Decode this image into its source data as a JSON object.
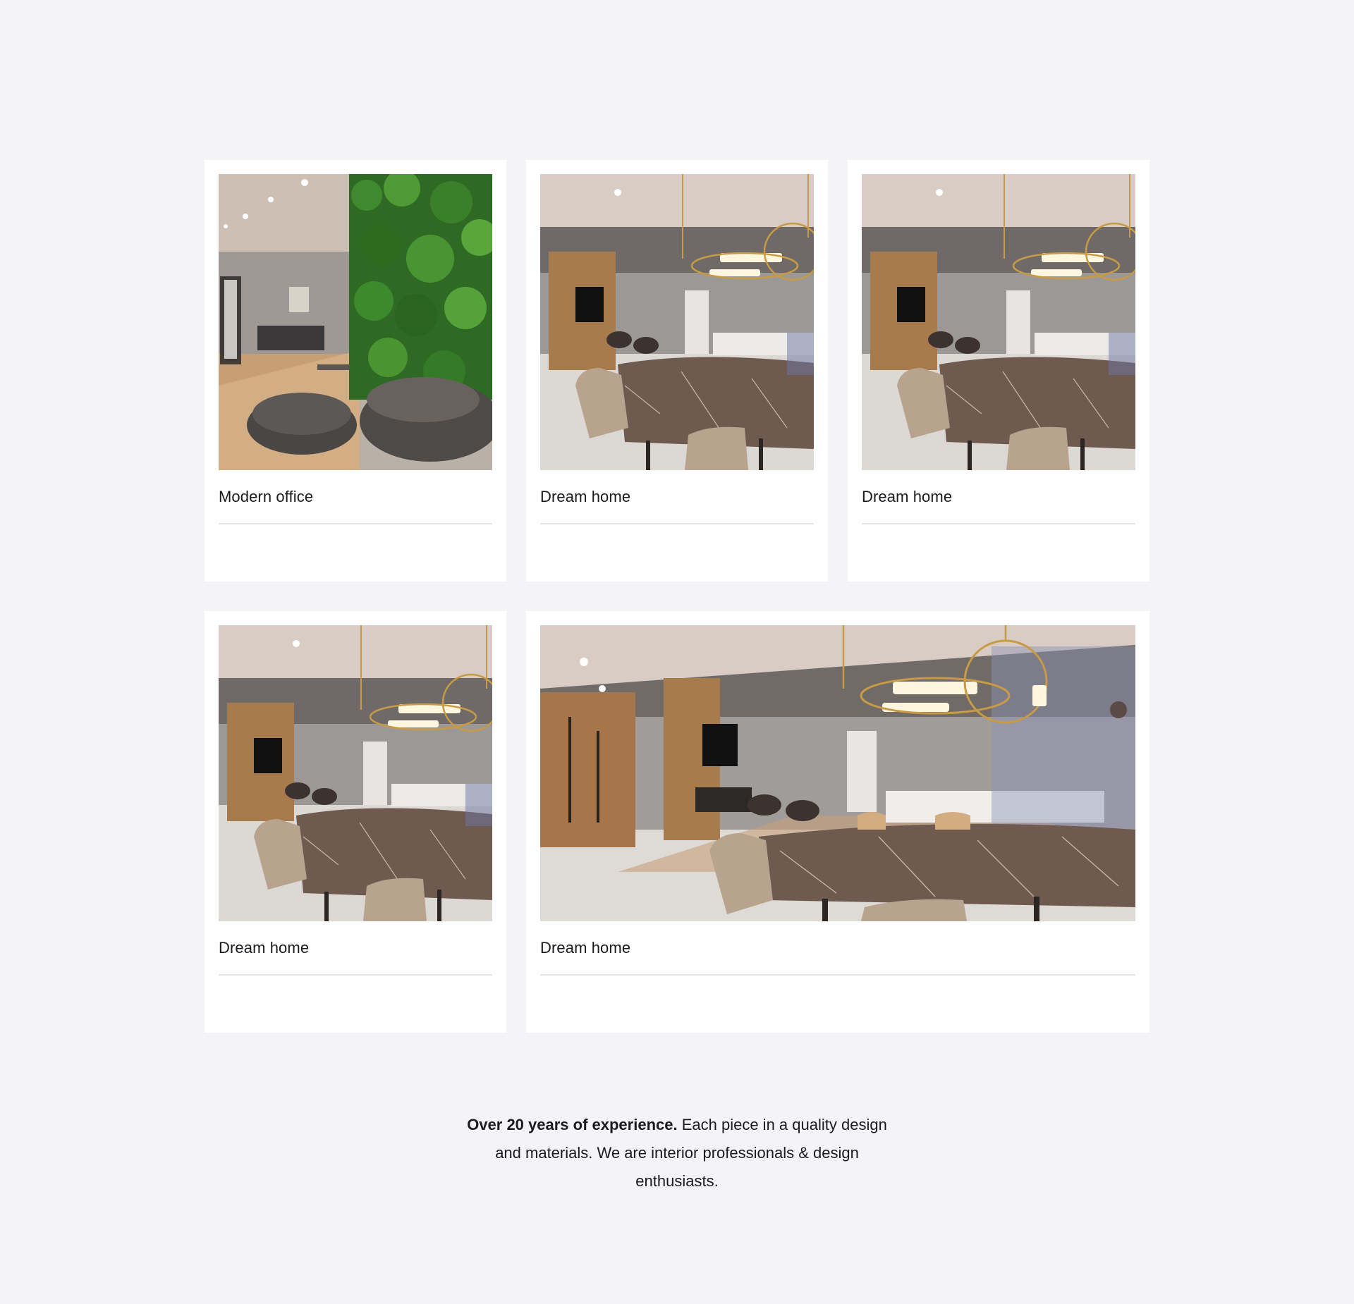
{
  "gallery": {
    "cards": [
      {
        "title": "Modern office",
        "photo": "office-living-room-with-green-plant-wall"
      },
      {
        "title": "Dream home",
        "photo": "dining-room-with-marble-table-and-gold-pendant-lamp"
      },
      {
        "title": "Dream home",
        "photo": "dining-room-with-marble-table-and-gold-pendant-lamp"
      },
      {
        "title": "Dream home",
        "photo": "dining-room-with-marble-table-and-gold-pendant-lamp"
      },
      {
        "title": "Dream home",
        "photo": "wide-dining-room-with-wood-panels-and-gold-pendant-lamp"
      }
    ]
  },
  "intro": {
    "lead": "Over 20 years of experience.",
    "body": " Each piece in a quality design and materials. We are interior professionals & design enthusiasts."
  },
  "colors": {
    "page_background": "#f4f4f6",
    "card_background": "#ffffff",
    "text": "#1b1b1f",
    "divider": "#e3e3e6"
  }
}
